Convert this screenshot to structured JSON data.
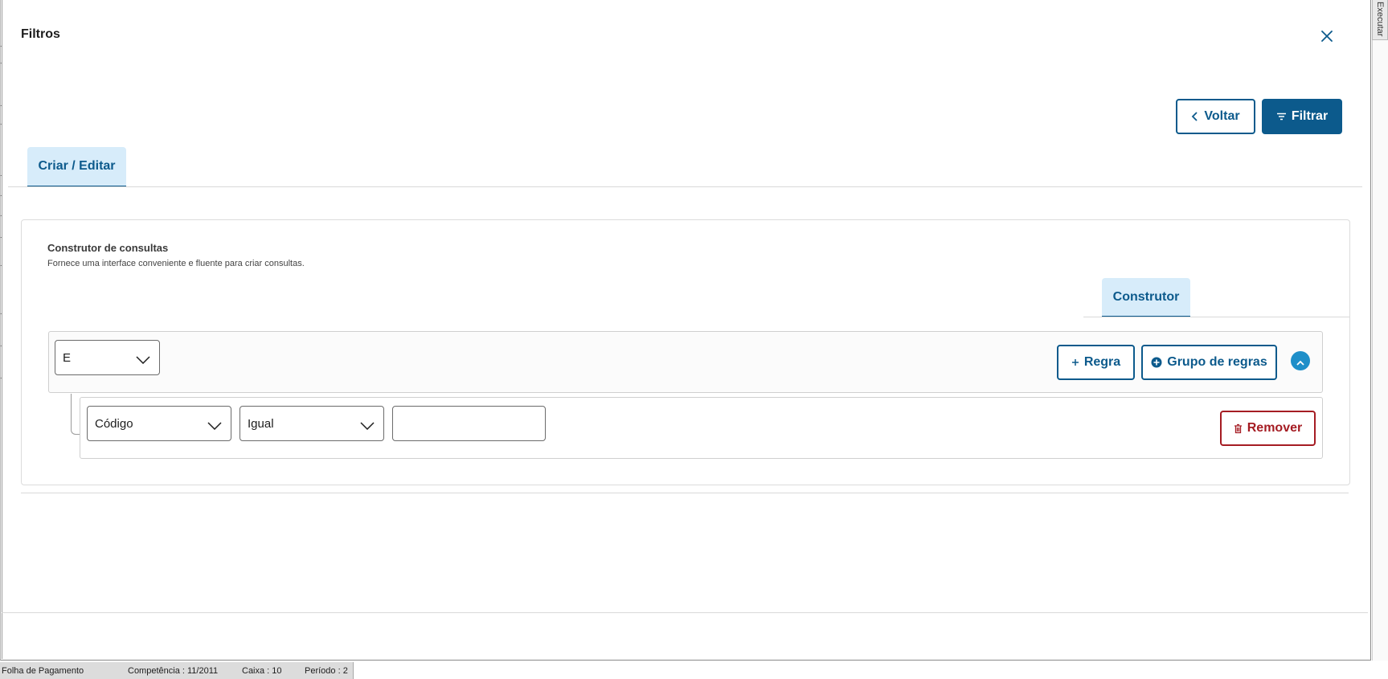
{
  "modal": {
    "title": "Filtros",
    "close_icon": "close-icon"
  },
  "side_tab": {
    "label": "Executar"
  },
  "actions": {
    "back_label": "Voltar",
    "back_icon": "chevron-left-icon",
    "filter_label": "Filtrar",
    "filter_icon": "filter-icon"
  },
  "tabs": [
    {
      "label": "Criar / Editar",
      "active": true
    }
  ],
  "query_builder": {
    "title": "Construtor de consultas",
    "description": "Fornece uma interface conveniente e fluente para criar consultas.",
    "tabs": [
      {
        "label": "Construtor",
        "active": true
      }
    ],
    "group": {
      "condition": "E",
      "add_rule_label": "Regra",
      "add_rule_icon": "plus-icon",
      "add_group_label": "Grupo de regras",
      "add_group_icon": "plus-circle-icon",
      "collapse_icon": "chevron-up-icon"
    },
    "rules": [
      {
        "field": "Código",
        "operator": "Igual",
        "value": "",
        "remove_label": "Remover",
        "remove_icon": "trash-icon"
      }
    ]
  },
  "status_bar": {
    "module": "Folha de Pagamento",
    "competencia": "Competência : 11/2011",
    "caixa": "Caixa : 10",
    "periodo": "Período : 2"
  },
  "colors": {
    "primary": "#0c5a8c",
    "tab_bg": "#d7ecfa",
    "danger": "#a51c23",
    "collapse_bg": "#1f8fc9"
  }
}
